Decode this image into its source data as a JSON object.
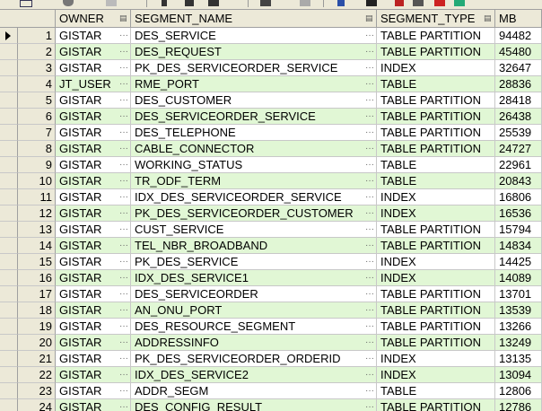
{
  "columns": {
    "owner": "OWNER",
    "segment_name": "SEGMENT_NAME",
    "segment_type": "SEGMENT_TYPE",
    "mb": "MB"
  },
  "rows": [
    {
      "n": "1",
      "owner": "GISTAR",
      "seg": "DES_SERVICE",
      "type": "TABLE PARTITION",
      "mb": "94482"
    },
    {
      "n": "2",
      "owner": "GISTAR",
      "seg": "DES_REQUEST",
      "type": "TABLE PARTITION",
      "mb": "45480"
    },
    {
      "n": "3",
      "owner": "GISTAR",
      "seg": "PK_DES_SERVICEORDER_SERVICE",
      "type": "INDEX",
      "mb": "32647"
    },
    {
      "n": "4",
      "owner": "JT_USER",
      "seg": "RME_PORT",
      "type": "TABLE",
      "mb": "28836"
    },
    {
      "n": "5",
      "owner": "GISTAR",
      "seg": "DES_CUSTOMER",
      "type": "TABLE PARTITION",
      "mb": "28418"
    },
    {
      "n": "6",
      "owner": "GISTAR",
      "seg": "DES_SERVICEORDER_SERVICE",
      "type": "TABLE PARTITION",
      "mb": "26438"
    },
    {
      "n": "7",
      "owner": "GISTAR",
      "seg": "DES_TELEPHONE",
      "type": "TABLE PARTITION",
      "mb": "25539"
    },
    {
      "n": "8",
      "owner": "GISTAR",
      "seg": "CABLE_CONNECTOR",
      "type": "TABLE PARTITION",
      "mb": "24727"
    },
    {
      "n": "9",
      "owner": "GISTAR",
      "seg": "WORKING_STATUS",
      "type": "TABLE",
      "mb": "22961"
    },
    {
      "n": "10",
      "owner": "GISTAR",
      "seg": "TR_ODF_TERM",
      "type": "TABLE",
      "mb": "20843"
    },
    {
      "n": "11",
      "owner": "GISTAR",
      "seg": "IDX_DES_SERVICEORDER_SERVICE",
      "type": "INDEX",
      "mb": "16806"
    },
    {
      "n": "12",
      "owner": "GISTAR",
      "seg": "PK_DES_SERVICEORDER_CUSTOMER",
      "type": "INDEX",
      "mb": "16536"
    },
    {
      "n": "13",
      "owner": "GISTAR",
      "seg": "CUST_SERVICE",
      "type": "TABLE PARTITION",
      "mb": "15794"
    },
    {
      "n": "14",
      "owner": "GISTAR",
      "seg": "TEL_NBR_BROADBAND",
      "type": "TABLE PARTITION",
      "mb": "14834"
    },
    {
      "n": "15",
      "owner": "GISTAR",
      "seg": "PK_DES_SERVICE",
      "type": "INDEX",
      "mb": "14425"
    },
    {
      "n": "16",
      "owner": "GISTAR",
      "seg": "IDX_DES_SERVICE1",
      "type": "INDEX",
      "mb": "14089"
    },
    {
      "n": "17",
      "owner": "GISTAR",
      "seg": "DES_SERVICEORDER",
      "type": "TABLE PARTITION",
      "mb": "13701"
    },
    {
      "n": "18",
      "owner": "GISTAR",
      "seg": "AN_ONU_PORT",
      "type": "TABLE PARTITION",
      "mb": "13539"
    },
    {
      "n": "19",
      "owner": "GISTAR",
      "seg": "DES_RESOURCE_SEGMENT",
      "type": "TABLE PARTITION",
      "mb": "13266"
    },
    {
      "n": "20",
      "owner": "GISTAR",
      "seg": "ADDRESSINFO",
      "type": "TABLE PARTITION",
      "mb": "13249"
    },
    {
      "n": "21",
      "owner": "GISTAR",
      "seg": "PK_DES_SERVICEORDER_ORDERID",
      "type": "INDEX",
      "mb": "13135"
    },
    {
      "n": "22",
      "owner": "GISTAR",
      "seg": "IDX_DES_SERVICE2",
      "type": "INDEX",
      "mb": "13094"
    },
    {
      "n": "23",
      "owner": "GISTAR",
      "seg": "ADDR_SEGM",
      "type": "TABLE",
      "mb": "12806"
    },
    {
      "n": "24",
      "owner": "GISTAR",
      "seg": "DES_CONFIG_RESULT",
      "type": "TABLE PARTITION",
      "mb": "12786"
    }
  ],
  "colors": {
    "row_alt": "#e1f7d5",
    "header_bg": "#ece9d8"
  }
}
